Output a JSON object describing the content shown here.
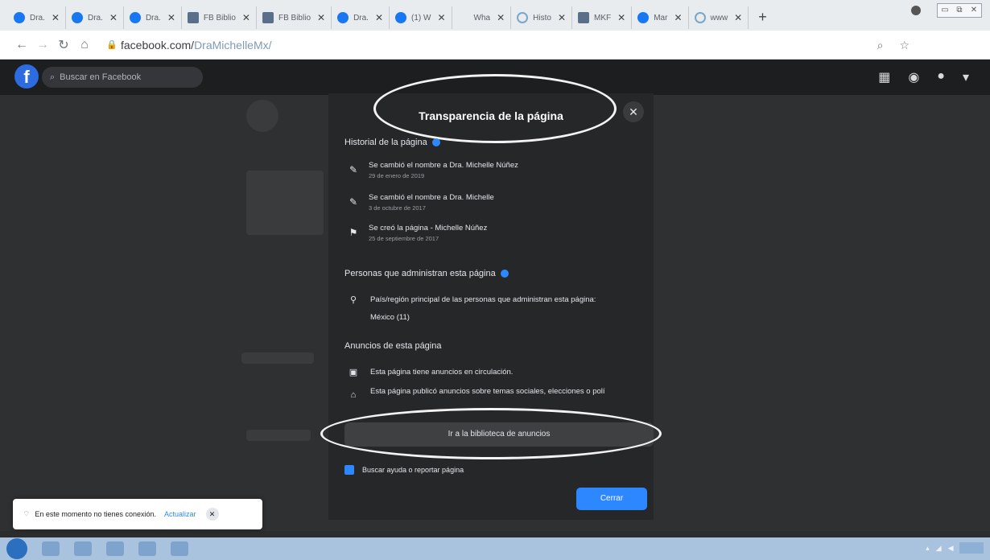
{
  "browser": {
    "tabs": [
      {
        "label": "Dra.",
        "icon": "facebook-icon"
      },
      {
        "label": "Dra.",
        "icon": "facebook-icon"
      },
      {
        "label": "Dra.",
        "icon": "facebook-icon"
      },
      {
        "label": "FB Biblio",
        "icon": "page-icon"
      },
      {
        "label": "FB Biblio",
        "icon": "page-icon"
      },
      {
        "label": "Dra.",
        "icon": "facebook-icon"
      },
      {
        "label": "(1) W",
        "icon": "facebook-icon"
      },
      {
        "label": "Wha",
        "icon": "blank-icon"
      },
      {
        "label": "Histo",
        "icon": "loading-icon"
      },
      {
        "label": "MKF",
        "icon": "image-icon"
      },
      {
        "label": "Mar",
        "icon": "facebook-icon"
      },
      {
        "label": "www",
        "icon": "globe-icon"
      }
    ],
    "url_domain": "facebook.com/",
    "url_path": "DraMichelleMx/"
  },
  "fb": {
    "logo": "f",
    "search_placeholder": "Buscar en Facebook"
  },
  "modal": {
    "title": "Transparencia de la página",
    "history_title": "Historial de la página",
    "history": [
      {
        "icon": "edit-icon",
        "text": "Se cambió el nombre a Dra. Michelle Núñez",
        "date": "29 de enero de 2019"
      },
      {
        "icon": "edit-icon",
        "text": "Se cambió el nombre a Dra. Michelle",
        "date": "3 de octubre de 2017"
      },
      {
        "icon": "flag-icon",
        "text": "Se creó la página - Michelle Núñez",
        "date": "25 de septiembre de 2017"
      }
    ],
    "admins_title": "Personas que administran esta página",
    "admins_text": "País/región principal de las personas que administran esta página:",
    "admins_country": "México (11)",
    "ads_title": "Anuncios de esta página",
    "ads_running": "Esta página tiene anuncios en circulación.",
    "ads_social": "Esta página publicó anuncios sobre temas sociales, elecciones o polí",
    "ad_library_button": "Ir a la biblioteca de anuncios",
    "help_link": "Buscar ayuda o reportar página",
    "close_button": "Cerrar"
  },
  "toast": {
    "message": "En este momento no tienes conexión.",
    "action": "Actualizar"
  },
  "colors": {
    "accent": "#2d88ff",
    "modal_bg": "#262729",
    "overlay_bg": "#2b2c2e"
  }
}
